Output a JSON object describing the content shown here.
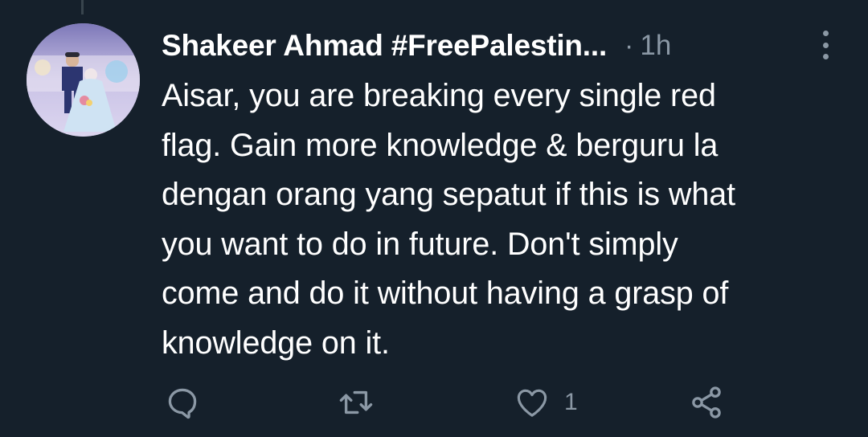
{
  "tweet": {
    "author": {
      "display_name": "Shakeer Ahmad #FreePalestin...",
      "avatar_icon": "wedding-couple-photo"
    },
    "separator": "·",
    "timestamp": "1h",
    "text_lines": [
      "Aisar, you are breaking every single red",
      "flag. Gain more knowledge & berguru la",
      "dengan orang yang sepatut if this is what",
      "you want to do in future. Don't simply",
      "come and do it without having a grasp of",
      "knowledge on it."
    ]
  },
  "actions": {
    "reply_icon": "comment-bubble-icon",
    "retweet_icon": "retweet-icon",
    "like_icon": "heart-icon",
    "like_count": "1",
    "share_icon": "share-icon"
  },
  "colors": {
    "background": "#15202b",
    "primary_text": "#ffffff",
    "secondary_text": "#8b98a5"
  }
}
